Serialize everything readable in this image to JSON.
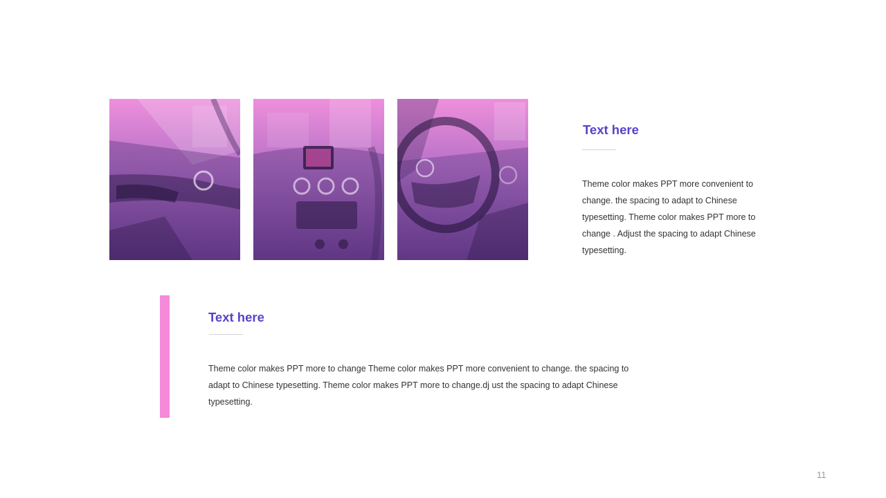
{
  "slide": {
    "page_number": "11",
    "colors": {
      "heading": "#5643c9",
      "accent_bar": "#f48ad9",
      "photo_top": "#ee8fdc",
      "photo_bottom": "#6a3d8f"
    },
    "photos": [
      {
        "subject": "car door interior"
      },
      {
        "subject": "car dashboard center console"
      },
      {
        "subject": "car steering wheel"
      }
    ],
    "right_block": {
      "heading": "Text here",
      "body": "Theme  color makes PPT more convenient  to change. the spacing to adapt to Chinese  typesetting. Theme  color makes PPT more to change . Adjust the spacing to adapt Chinese  typesetting."
    },
    "bottom_block": {
      "heading": "Text here",
      "body": "Theme  color makes PPT more to change Theme  color makes PPT more convenient  to change. the spacing to adapt to Chinese  typesetting. Theme  color makes PPT more to change.dj ust the spacing to adapt Chinese  typesetting."
    }
  }
}
